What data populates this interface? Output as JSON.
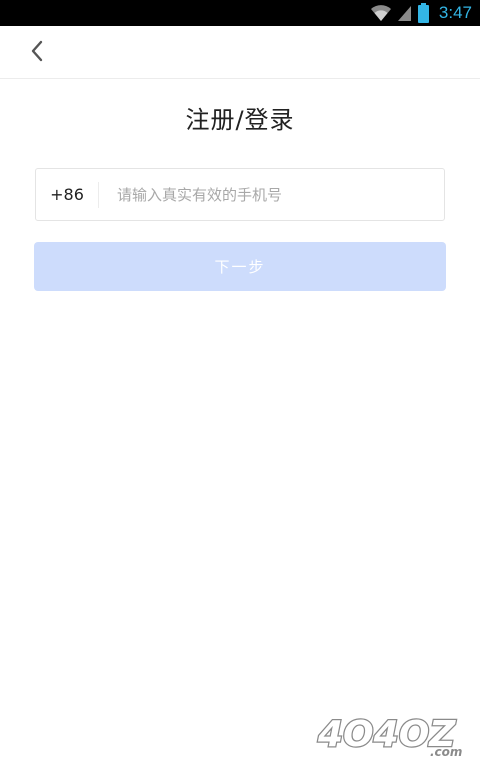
{
  "status_bar": {
    "time": "3:47",
    "icons": [
      "wifi-icon",
      "cell-signal-icon",
      "battery-icon"
    ],
    "clock_color": "#33b5e5"
  },
  "nav": {
    "back_icon": "chevron-left-icon"
  },
  "title": "注册/登录",
  "phone": {
    "country_code": "+86",
    "placeholder": "请输入真实有效的手机号",
    "value": ""
  },
  "next_button": {
    "label": "下一步",
    "enabled": false,
    "color": "#cddcfc"
  },
  "watermark": {
    "text": "4O4OZ",
    "suffix": ".com"
  }
}
